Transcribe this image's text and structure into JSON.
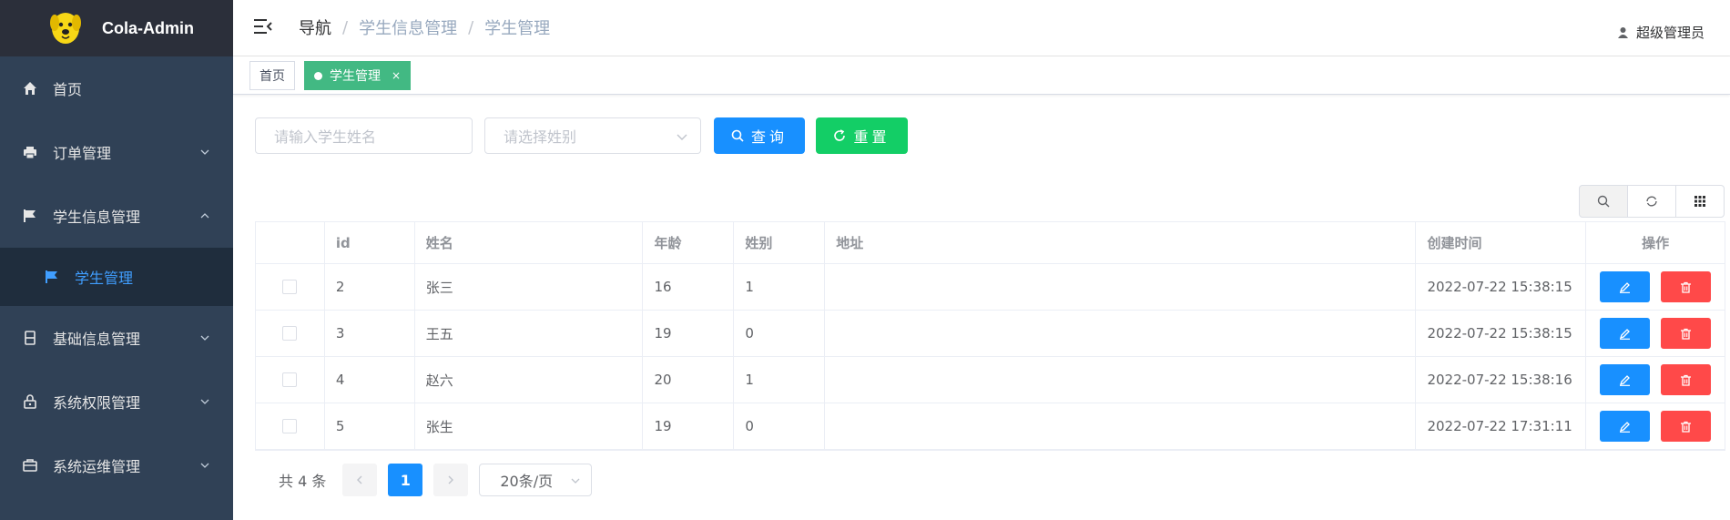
{
  "app": {
    "name": "Cola-Admin"
  },
  "sidebar": {
    "items": [
      {
        "label": "首页",
        "icon": "home-icon"
      },
      {
        "label": "订单管理",
        "icon": "printer-icon"
      },
      {
        "label": "学生信息管理",
        "icon": "flag-icon",
        "expanded": true
      },
      {
        "label": "基础信息管理",
        "icon": "document-icon"
      },
      {
        "label": "系统权限管理",
        "icon": "lock-icon"
      },
      {
        "label": "系统运维管理",
        "icon": "briefcase-icon"
      }
    ],
    "sub_items": [
      {
        "label": "学生管理",
        "icon": "flag-icon",
        "active": true
      }
    ]
  },
  "header": {
    "breadcrumb": [
      "导航",
      "学生信息管理",
      "学生管理"
    ],
    "user": "超级管理员"
  },
  "tags": [
    {
      "label": "首页",
      "active": false
    },
    {
      "label": "学生管理",
      "active": true,
      "close": "×"
    }
  ],
  "search": {
    "name_placeholder": "请输入学生姓名",
    "gender_placeholder": "请选择姓别",
    "query_label": "查询",
    "reset_label": "重置"
  },
  "table": {
    "columns": [
      "id",
      "姓名",
      "年龄",
      "姓别",
      "地址",
      "创建时间",
      "操作"
    ],
    "rows": [
      {
        "id": "2",
        "name": "张三",
        "age": "16",
        "sex": "1",
        "addr": "",
        "time": "2022-07-22 15:38:15"
      },
      {
        "id": "3",
        "name": "王五",
        "age": "19",
        "sex": "0",
        "addr": "",
        "time": "2022-07-22 15:38:15"
      },
      {
        "id": "4",
        "name": "赵六",
        "age": "20",
        "sex": "1",
        "addr": "",
        "time": "2022-07-22 15:38:16"
      },
      {
        "id": "5",
        "name": "张生",
        "age": "19",
        "sex": "0",
        "addr": "",
        "time": "2022-07-22 17:31:11"
      }
    ]
  },
  "pagination": {
    "total": "共 4 条",
    "current": "1",
    "page_size": "20条/页"
  },
  "colors": {
    "sidebar_bg": "#304156",
    "primary": "#1890ff",
    "success": "#13ce66",
    "danger": "#ff4949",
    "tag_active": "#42b983"
  }
}
